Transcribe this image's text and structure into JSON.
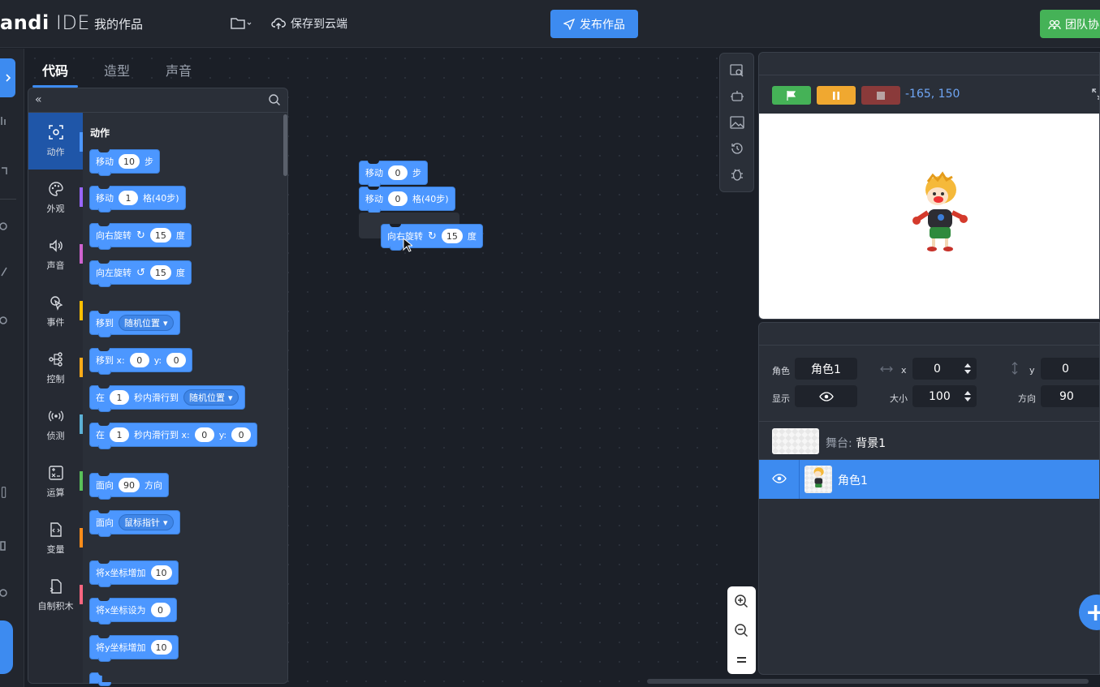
{
  "header": {
    "logo_bold": "andi",
    "logo_light": " IDE",
    "my_works": "我的作品",
    "cloud_save": "保存到云端",
    "publish": "发布作品",
    "team": "团队协"
  },
  "tabs": [
    "代码",
    "造型",
    "声音"
  ],
  "categories": [
    {
      "label": "动作",
      "icon": "motion-icon",
      "color": "#4c97ff"
    },
    {
      "label": "外观",
      "icon": "palette-icon",
      "color": "#9966ff"
    },
    {
      "label": "声音",
      "icon": "speaker-icon",
      "color": "#cf63cf"
    },
    {
      "label": "事件",
      "icon": "event-icon",
      "color": "#ffbf00"
    },
    {
      "label": "控制",
      "icon": "control-icon",
      "color": "#ffab19"
    },
    {
      "label": "侦测",
      "icon": "sensing-icon",
      "color": "#5cb1d6"
    },
    {
      "label": "运算",
      "icon": "operators-icon",
      "color": "#59c059"
    },
    {
      "label": "变量",
      "icon": "variables-icon",
      "color": "#ff8c1a"
    },
    {
      "label": "自制积木",
      "icon": "myblocks-icon",
      "color": "#ff6680"
    }
  ],
  "palette": {
    "section": "动作",
    "blocks": {
      "move": {
        "a": "移动",
        "v": "10",
        "b": "步"
      },
      "move_grid": {
        "a": "移动",
        "v": "1",
        "b": "格(40步)"
      },
      "turn_right": {
        "a": "向右旋转",
        "v": "15",
        "b": "度"
      },
      "turn_left": {
        "a": "向左旋转",
        "v": "15",
        "b": "度"
      },
      "goto": {
        "a": "移到",
        "d": "随机位置"
      },
      "goto_xy": {
        "a": "移到 x:",
        "x": "0",
        "b": "y:",
        "y": "0"
      },
      "glide": {
        "a": "在",
        "v": "1",
        "b": "秒内滑行到",
        "d": "随机位置"
      },
      "glide_xy": {
        "a": "在",
        "v": "1",
        "b": "秒内滑行到 x:",
        "x": "0",
        "c": "y:",
        "y": "0"
      },
      "point": {
        "a": "面向",
        "v": "90",
        "b": "方向"
      },
      "point_towards": {
        "a": "面向",
        "d": "鼠标指针"
      },
      "change_x": {
        "a": "将x坐标增加",
        "v": "10"
      },
      "set_x": {
        "a": "将x坐标设为",
        "v": "0"
      },
      "change_y": {
        "a": "将y坐标增加",
        "v": "10"
      }
    }
  },
  "workspace": {
    "move": {
      "a": "移动",
      "v": "0",
      "b": "步"
    },
    "move_grid": {
      "a": "移动",
      "v": "0",
      "b": "格(40步)"
    },
    "turn_right": {
      "a": "向右旋转",
      "v": "15",
      "b": "度"
    }
  },
  "stage": {
    "coords": "-165, 150"
  },
  "sprite_info": {
    "role_label": "角色",
    "role_name": "角色1",
    "x_label": "x",
    "x_value": "0",
    "y_label": "y",
    "y_value": "0",
    "show_label": "显示",
    "size_label": "大小",
    "size_value": "100",
    "dir_label": "方向",
    "dir_value": "90"
  },
  "stage_row": {
    "prefix": "舞台: ",
    "name": "背景1"
  },
  "sprite_row": {
    "name": "角色1"
  },
  "colors": {
    "accent": "#3d8bf0",
    "motion_block": "#4c97ff",
    "green": "#45b257",
    "orange": "#f0a830",
    "stop": "#8a3a3a"
  }
}
